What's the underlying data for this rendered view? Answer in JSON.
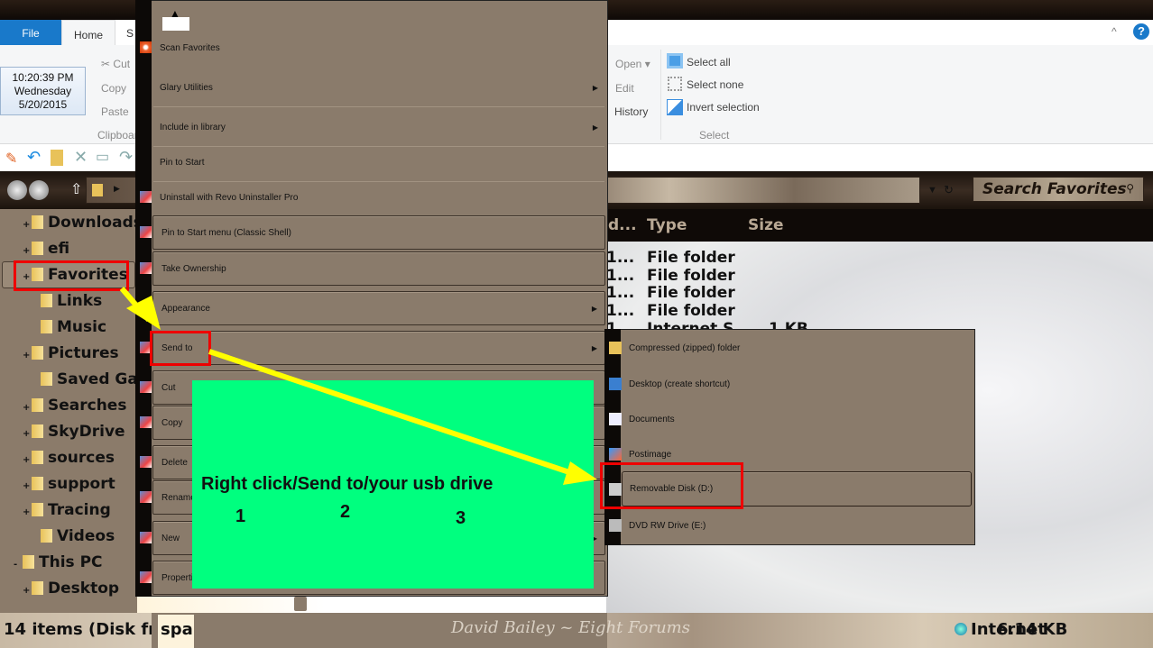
{
  "ribbon": {
    "tabs": [
      "File",
      "Home",
      "S"
    ],
    "clipboard": {
      "cut": "Cut",
      "copy": "Copy",
      "paste": "Paste",
      "group": "Clipboard"
    },
    "open": {
      "open": "Open",
      "edit": "Edit",
      "history": "History"
    },
    "select": {
      "select_all": "Select all",
      "select_none": "Select none",
      "invert": "Invert selection",
      "group": "Select"
    }
  },
  "clock": {
    "time": "10:20:39 PM",
    "day": "Wednesday",
    "date": "5/20/2015"
  },
  "search": {
    "placeholder": "Search Favorites"
  },
  "nav": {
    "items": [
      {
        "label": "Downloads",
        "expand": "+"
      },
      {
        "label": "efi",
        "expand": "+"
      },
      {
        "label": "Favorites",
        "expand": "+"
      },
      {
        "label": "Links",
        "expand": ""
      },
      {
        "label": "Music",
        "expand": ""
      },
      {
        "label": "Pictures",
        "expand": "+"
      },
      {
        "label": "Saved Gam",
        "expand": ""
      },
      {
        "label": "Searches",
        "expand": "+"
      },
      {
        "label": "SkyDrive",
        "expand": "+"
      },
      {
        "label": "sources",
        "expand": "+"
      },
      {
        "label": "support",
        "expand": "+"
      },
      {
        "label": "Tracing",
        "expand": "+"
      },
      {
        "label": "Videos",
        "expand": ""
      },
      {
        "label": "This PC",
        "expand": "-"
      },
      {
        "label": "Desktop",
        "expand": "+"
      }
    ]
  },
  "columns": {
    "date": "d...",
    "type": "Type",
    "size": "Size"
  },
  "files": [
    {
      "date": "1...",
      "type": "File folder",
      "size": ""
    },
    {
      "date": "1...",
      "type": "File folder",
      "size": ""
    },
    {
      "date": "1...",
      "type": "File folder",
      "size": ""
    },
    {
      "date": "1...",
      "type": "File folder",
      "size": ""
    },
    {
      "date": "1...",
      "type": "Internet S",
      "size": "1 KB"
    }
  ],
  "context_menu": {
    "items": [
      {
        "label": "Scan Favorites",
        "submenu": false
      },
      {
        "label": "Glary Utilities",
        "submenu": true
      },
      {
        "label": "Include in library",
        "submenu": true
      },
      {
        "label": "Pin to Start",
        "submenu": false
      },
      {
        "label": "Uninstall with Revo Uninstaller Pro",
        "submenu": false
      },
      {
        "label": "Pin to Start menu (Classic Shell)",
        "submenu": false
      },
      {
        "label": "Take Ownership",
        "submenu": false
      },
      {
        "label": "Appearance",
        "submenu": true
      },
      {
        "label": "Send to",
        "submenu": true
      },
      {
        "label": "Cut",
        "submenu": false
      },
      {
        "label": "Copy",
        "submenu": false
      },
      {
        "label": "Delete",
        "submenu": false
      },
      {
        "label": "Rename",
        "submenu": false
      },
      {
        "label": "New",
        "submenu": true
      },
      {
        "label": "Properties",
        "submenu": false
      }
    ]
  },
  "send_to": {
    "items": [
      "Compressed (zipped) folder",
      "Desktop (create shortcut)",
      "Documents",
      "Postimage",
      "Removable Disk (D:)",
      "DVD RW Drive (E:)"
    ],
    "highlighted": "Removable Disk (D:)"
  },
  "annotation": {
    "text": "Right click/Send to/your usb drive",
    "step1": "1",
    "step2": "2",
    "step3": "3",
    "arrow_color": "#ffff00",
    "box_color": "#ff0000",
    "panel_color": "#00ff7f"
  },
  "status": {
    "items": "14 items (Disk fr",
    "spa": "spa",
    "size": "6.14 KB",
    "zone": "Internet"
  },
  "watermark": "David Bailey ~ Eight Forums"
}
